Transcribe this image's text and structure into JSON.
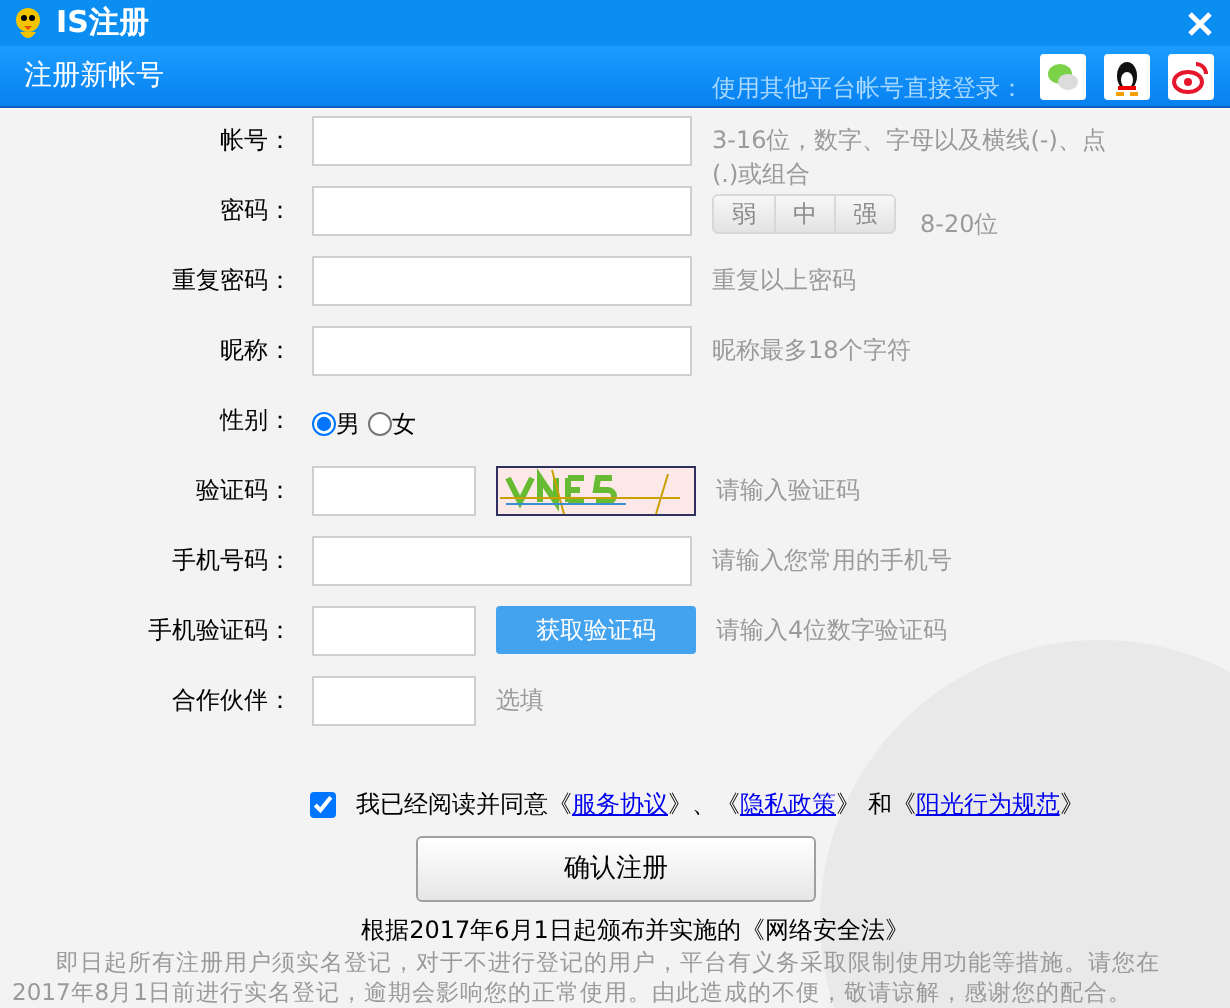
{
  "window": {
    "title": "IS注册"
  },
  "header": {
    "title": "注册新帐号",
    "social_label": "使用其他平台帐号直接登录："
  },
  "fields": [
    {
      "kind": "input",
      "label": "帐号：",
      "hint": "3-16位，数字、字母以及横线(-)、点(.)或组合"
    },
    {
      "kind": "password",
      "label": "密码：",
      "strength": [
        "弱",
        "中",
        "强"
      ],
      "hint": "8-20位"
    },
    {
      "kind": "input",
      "label": "重复密码：",
      "hint": "重复以上密码"
    },
    {
      "kind": "input",
      "label": "昵称：",
      "hint": "昵称最多18个字符"
    },
    {
      "kind": "radio",
      "label": "性别：",
      "options": [
        {
          "label": "男",
          "selected": true
        },
        {
          "label": "女",
          "selected": false
        }
      ]
    },
    {
      "kind": "captcha",
      "label": "验证码：",
      "hint": "请输入验证码"
    },
    {
      "kind": "input",
      "label": "手机号码：",
      "hint": "请输入您常用的手机号"
    },
    {
      "kind": "sms",
      "label": "手机验证码：",
      "button": "获取验证码",
      "hint": "请输入4位数字验证码"
    },
    {
      "kind": "short",
      "label": "合作伙伴：",
      "hint": "选填"
    }
  ],
  "agreement": {
    "checked": true,
    "parts": [
      {
        "kind": "text",
        "text": "我已经阅读并同意《"
      },
      {
        "kind": "link",
        "text": "服务协议"
      },
      {
        "kind": "text",
        "text": "》、《"
      },
      {
        "kind": "link",
        "text": "隐私政策"
      },
      {
        "kind": "text",
        "text": "》 和《"
      },
      {
        "kind": "link",
        "text": "阳光行为规范"
      },
      {
        "kind": "text",
        "text": "》"
      }
    ]
  },
  "submit": "确认注册",
  "notice": {
    "title": "根据2017年6月1日起颁布并实施的《网络安全法》",
    "body": "即日起所有注册用户须实名登记，对于不进行登记的用户，平台有义务采取限制使用功能等措施。请您在2017年8月1日前进行实名登记，逾期会影响您的正常使用。由此造成的不便，敬请谅解，感谢您的配合。"
  }
}
